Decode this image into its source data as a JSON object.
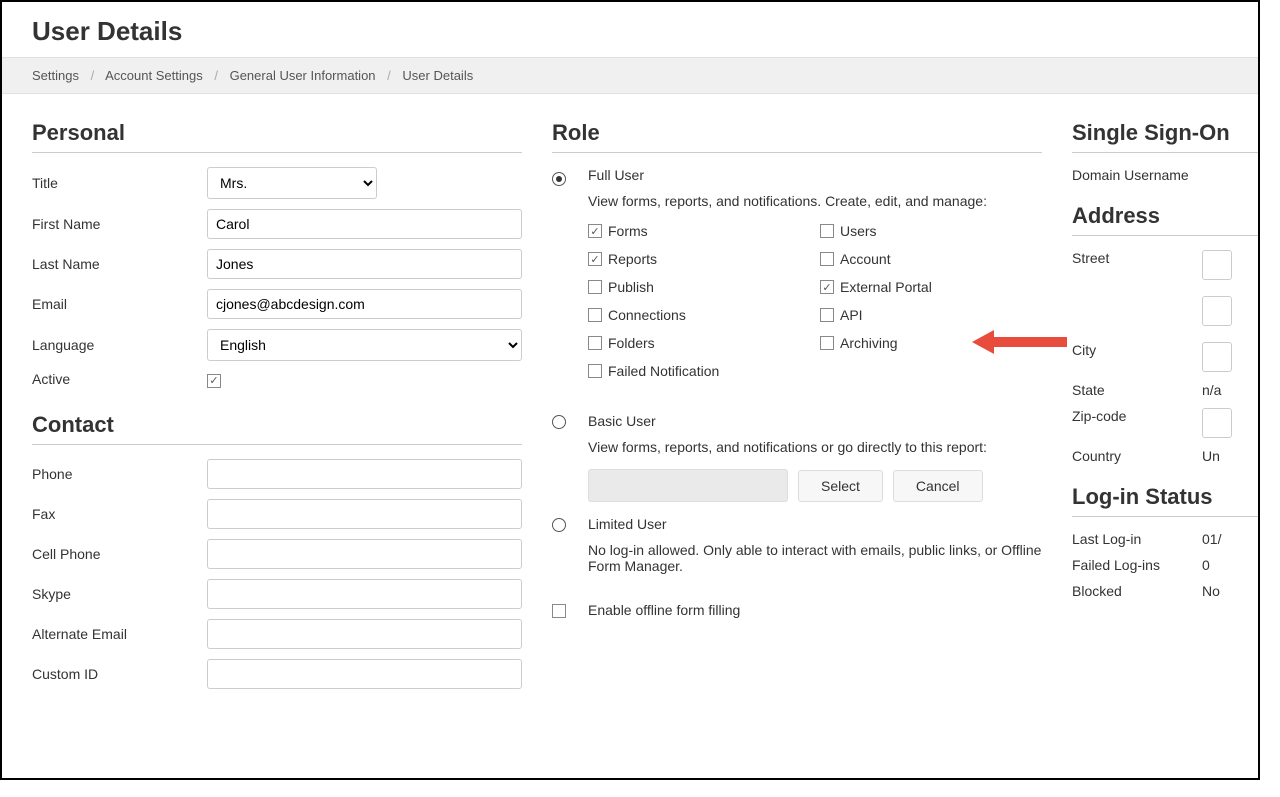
{
  "header": {
    "title": "User Details"
  },
  "breadcrumb": [
    "Settings",
    "Account Settings",
    "General User Information",
    "User Details"
  ],
  "personal": {
    "section": "Personal",
    "title_label": "Title",
    "title_value": "Mrs.",
    "first_name_label": "First Name",
    "first_name_value": "Carol",
    "last_name_label": "Last Name",
    "last_name_value": "Jones",
    "email_label": "Email",
    "email_value": "cjones@abcdesign.com",
    "language_label": "Language",
    "language_value": "English",
    "active_label": "Active",
    "active_checked": true
  },
  "contact": {
    "section": "Contact",
    "phone_label": "Phone",
    "fax_label": "Fax",
    "cell_label": "Cell Phone",
    "skype_label": "Skype",
    "alt_email_label": "Alternate Email",
    "custom_id_label": "Custom ID"
  },
  "role": {
    "section": "Role",
    "full_user": {
      "name": "Full User",
      "desc": "View forms, reports, and notifications. Create, edit, and manage:",
      "perms_left": [
        {
          "label": "Forms",
          "checked": true
        },
        {
          "label": "Reports",
          "checked": true
        },
        {
          "label": "Publish",
          "checked": false
        },
        {
          "label": "Connections",
          "checked": false
        },
        {
          "label": "Folders",
          "checked": false
        },
        {
          "label": "Failed Notification",
          "checked": false
        }
      ],
      "perms_right": [
        {
          "label": "Users",
          "checked": false
        },
        {
          "label": "Account",
          "checked": false
        },
        {
          "label": "External Portal",
          "checked": true
        },
        {
          "label": "API",
          "checked": false
        },
        {
          "label": "Archiving",
          "checked": false
        }
      ]
    },
    "basic_user": {
      "name": "Basic User",
      "desc": "View forms, reports, and notifications or go directly to this report:",
      "select_btn": "Select",
      "cancel_btn": "Cancel"
    },
    "limited_user": {
      "name": "Limited User",
      "desc": "No log-in allowed. Only able to interact with emails, public links, or Offline Form Manager."
    },
    "offline_label": "Enable offline form filling"
  },
  "sso": {
    "section": "Single Sign-On",
    "domain_label": "Domain Username"
  },
  "address": {
    "section": "Address",
    "street_label": "Street",
    "city_label": "City",
    "state_label": "State",
    "state_value": "n/a",
    "zip_label": "Zip-code",
    "country_label": "Country",
    "country_value": "Un"
  },
  "login_status": {
    "section": "Log-in Status",
    "last_login_label": "Last Log-in",
    "last_login_value": "01/",
    "failed_label": "Failed Log-ins",
    "failed_value": "0",
    "blocked_label": "Blocked",
    "blocked_value": "No"
  }
}
